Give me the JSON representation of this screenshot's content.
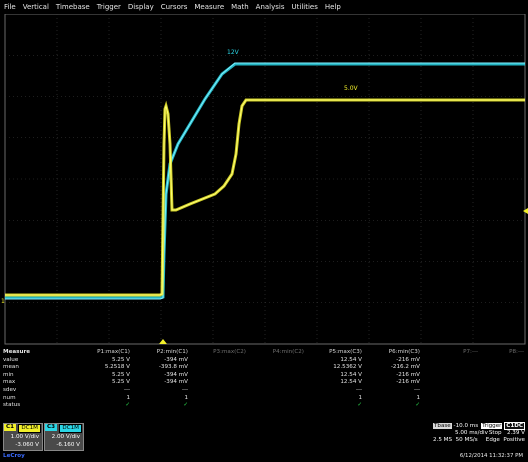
{
  "menu": [
    "File",
    "Vertical",
    "Timebase",
    "Trigger",
    "Display",
    "Cursors",
    "Measure",
    "Math",
    "Analysis",
    "Utilities",
    "Help"
  ],
  "waveform": {
    "labels": {
      "cyan": "12V",
      "yellow": "5.0V",
      "marker_left": "1",
      "trigger_right": "◄"
    },
    "colors": {
      "c1": "#f2f02a",
      "c2": "#2ad6e6",
      "grid": "#3c3c3c"
    }
  },
  "measure": {
    "row_labels": [
      "Measure",
      "value",
      "mean",
      "min",
      "max",
      "sdev",
      "num",
      "status"
    ],
    "params": [
      {
        "header": "P1:max(C1)",
        "active": true,
        "values": [
          "5.25 V",
          "5.2518 V",
          "5.25 V",
          "5.25 V",
          "---",
          "1",
          "✓"
        ]
      },
      {
        "header": "P2:min(C1)",
        "active": true,
        "values": [
          "-394 mV",
          "-393.8 mV",
          "-394 mV",
          "-394 mV",
          "---",
          "1",
          "✓"
        ]
      },
      {
        "header": "P3:max(C2)",
        "active": false,
        "values": [
          "",
          "",
          "",
          "",
          "",
          "",
          ""
        ]
      },
      {
        "header": "P4:min(C2)",
        "active": false,
        "values": [
          "",
          "",
          "",
          "",
          "",
          "",
          ""
        ]
      },
      {
        "header": "P5:max(C3)",
        "active": true,
        "values": [
          "12.54 V",
          "12.5362 V",
          "12.54 V",
          "12.54 V",
          "---",
          "1",
          "✓"
        ]
      },
      {
        "header": "P6:min(C3)",
        "active": true,
        "values": [
          "-216 mV",
          "-216.2 mV",
          "-216 mV",
          "-216 mV",
          "---",
          "1",
          "✓"
        ]
      },
      {
        "header": "P7:---",
        "active": false,
        "values": [
          "",
          "",
          "",
          "",
          "",
          "",
          ""
        ]
      },
      {
        "header": "P8:---",
        "active": false,
        "values": [
          "",
          "",
          "",
          "",
          "",
          "",
          ""
        ]
      }
    ]
  },
  "channels": [
    {
      "tag": "C1",
      "coupling": "DC1M",
      "vdiv": "1.00 V/div",
      "offset": "-3.060 V",
      "color": "#f2f02a"
    },
    {
      "tag": "C3",
      "coupling": "DC1M",
      "vdiv": "2.00 V/div",
      "offset": "-6.160 V",
      "color": "#2ad6e6"
    }
  ],
  "timebase": {
    "tbase_label": "Tbase",
    "tbase_value": "-10.0 ms",
    "trigger_label": "Trigger",
    "trigger_src": "C1DC",
    "tdiv": "5.00 ms/div",
    "mode": "Stop",
    "level": "2.39 V",
    "samples": "2.5 MS",
    "rate": "50 MS/s",
    "type": "Edge",
    "slope": "Positive"
  },
  "timestamp": "6/12/2014 11:32:37 PM",
  "brand": "LeCroy"
}
